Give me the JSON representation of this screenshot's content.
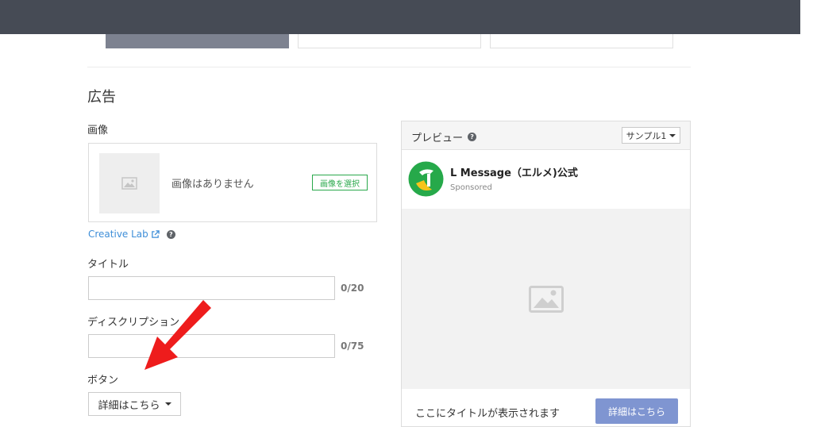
{
  "section": {
    "title": "広告"
  },
  "image_field": {
    "label": "画像",
    "empty_text": "画像はありません",
    "select_button": "画像を選択"
  },
  "creative_lab": {
    "label": "Creative Lab",
    "icons": [
      "external-link-icon",
      "help-icon"
    ]
  },
  "title_field": {
    "label": "タイトル",
    "value": "",
    "counter": "0/20"
  },
  "description_field": {
    "label": "ディスクリプション",
    "value": "",
    "counter": "0/75"
  },
  "button_field": {
    "label": "ボタン",
    "selected": "詳細はこちら"
  },
  "preview": {
    "title": "プレビュー",
    "sample_select": "サンプル1",
    "account_name": "L Message（エルメ)公式",
    "sponsored": "Sponsored",
    "footer_title": "ここにタイトルが表示されます",
    "cta_label": "詳細はこちら"
  },
  "colors": {
    "topbar": "#464b55",
    "accent_green": "#2aa94c",
    "link_blue": "#3e8ed8",
    "cta": "#7f95d1",
    "annotation_arrow": "#ee1c1c"
  }
}
